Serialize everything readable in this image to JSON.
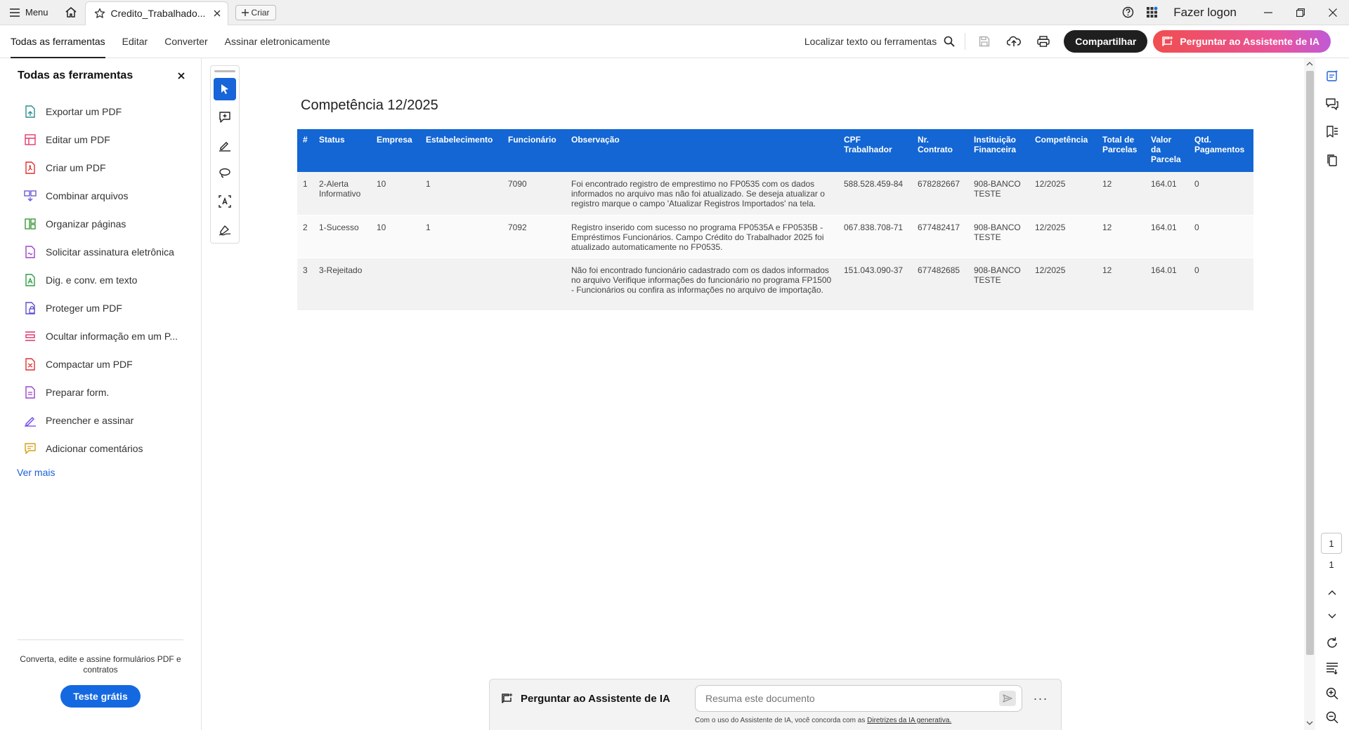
{
  "titlebar": {
    "menu_label": "Menu",
    "tab_title": "Credito_Trabalhado...",
    "new_label": "Criar",
    "login_label": "Fazer logon"
  },
  "toolbar": {
    "nav": [
      "Todas as ferramentas",
      "Editar",
      "Converter",
      "Assinar eletronicamente"
    ],
    "find_label": "Localizar texto ou ferramentas",
    "share_label": "Compartilhar",
    "ai_label": "Perguntar ao Assistente de IA"
  },
  "leftpanel": {
    "title": "Todas as ferramentas",
    "items": [
      {
        "label": "Exportar um PDF",
        "icon": "export-pdf-icon",
        "color": "#2d8f8f"
      },
      {
        "label": "Editar um PDF",
        "icon": "edit-pdf-icon",
        "color": "#e23b6b"
      },
      {
        "label": "Criar um PDF",
        "icon": "create-pdf-icon",
        "color": "#e03030"
      },
      {
        "label": "Combinar arquivos",
        "icon": "combine-files-icon",
        "color": "#6a5bd6"
      },
      {
        "label": "Organizar páginas",
        "icon": "organize-pages-icon",
        "color": "#3a9a3a"
      },
      {
        "label": "Solicitar assinatura eletrônica",
        "icon": "request-signature-icon",
        "color": "#9b45c7"
      },
      {
        "label": "Dig. e conv. em texto",
        "icon": "scan-ocr-icon",
        "color": "#2f9e44"
      },
      {
        "label": "Proteger um PDF",
        "icon": "protect-pdf-icon",
        "color": "#5a4fd0"
      },
      {
        "label": "Ocultar informação em um P...",
        "icon": "redact-icon",
        "color": "#d6336c"
      },
      {
        "label": "Compactar um PDF",
        "icon": "compress-pdf-icon",
        "color": "#e03030"
      },
      {
        "label": "Preparar form.",
        "icon": "prepare-form-icon",
        "color": "#9b45c7"
      },
      {
        "label": "Preencher e assinar",
        "icon": "fill-sign-icon",
        "color": "#7048e8"
      },
      {
        "label": "Adicionar comentários",
        "icon": "add-comment-icon",
        "color": "#d4a017"
      }
    ],
    "more_label": "Ver mais",
    "promo_text": "Converta, edite e assine formulários PDF e contratos",
    "trial_label": "Teste grátis"
  },
  "document": {
    "title": "Competência 12/2025",
    "columns": [
      "#",
      "Status",
      "Empresa",
      "Estabelecimento",
      "Funcionário",
      "Observação",
      "CPF Trabalhador",
      "Nr. Contrato",
      "Instituição Financeira",
      "Competência",
      "Total de Parcelas",
      "Valor da Parcela",
      "Qtd. Pagamentos"
    ],
    "rows": [
      [
        "1",
        "2-Alerta Informativo",
        "10",
        "1",
        "7090",
        "Foi encontrado registro de emprestimo no FP0535 com os dados informados no arquivo mas não foi atualizado. Se deseja atualizar o registro marque o campo 'Atualizar Registros Importados' na tela.",
        "588.528.459-84",
        "678282667",
        "908-BANCO TESTE",
        "12/2025",
        "12",
        "164.01",
        "0"
      ],
      [
        "2",
        "1-Sucesso",
        "10",
        "1",
        "7092",
        "Registro inserido com sucesso no programa FP0535A e FP0535B - Empréstimos Funcionários. Campo Crédito do Trabalhador 2025 foi atualizado automaticamente no FP0535.",
        "067.838.708-71",
        "677482417",
        "908-BANCO TESTE",
        "12/2025",
        "12",
        "164.01",
        "0"
      ],
      [
        "3",
        "3-Rejeitado",
        "",
        "",
        "",
        "Não foi encontrado funcionário cadastrado com os dados informados no arquivo Verifique informações do funcionário no programa FP1500 - Funcionários ou confira as informações no arquivo de importação.",
        "151.043.090-37",
        "677482685",
        "908-BANCO TESTE",
        "12/2025",
        "12",
        "164.01",
        "0"
      ]
    ]
  },
  "aibar": {
    "label": "Perguntar ao Assistente de IA",
    "placeholder": "Resuma este documento",
    "disclaimer": "Com o uso do Assistente de IA, você concorda com as ",
    "disclaimer_link": "Diretrizes da IA generativa."
  },
  "pager": {
    "current": "1",
    "total": "1"
  },
  "colors": {
    "accent": "#1366d3",
    "share": "#1f1f1f",
    "ai": "#f04e4e"
  }
}
